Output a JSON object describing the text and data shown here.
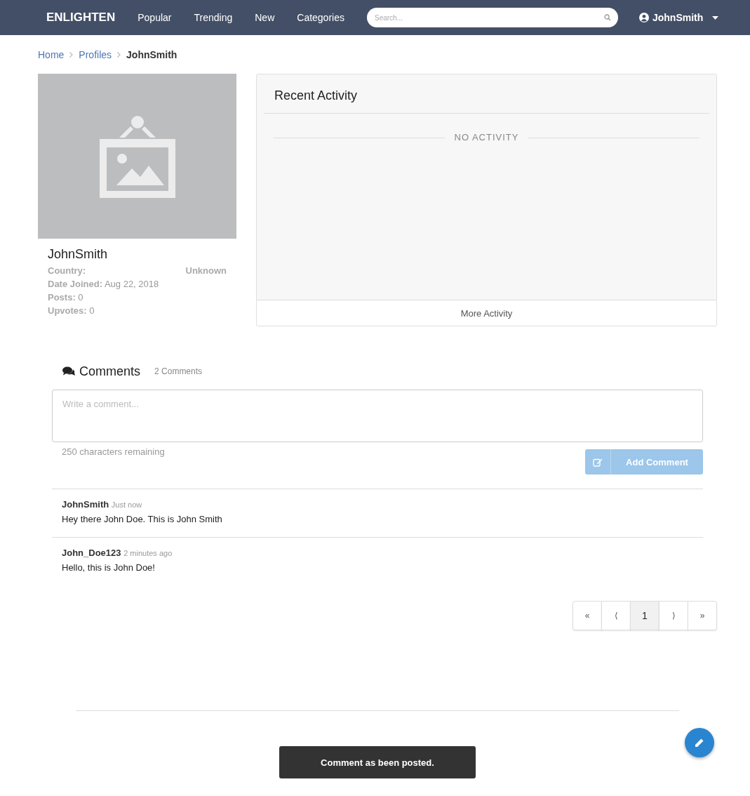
{
  "navbar": {
    "brand": "ENLIGHTEN",
    "links": [
      "Popular",
      "Trending",
      "New",
      "Categories"
    ],
    "search": {
      "placeholder": "Search..."
    },
    "user": "JohnSmith"
  },
  "breadcrumb": [
    {
      "label": "Home",
      "current": false
    },
    {
      "label": "Profiles",
      "current": false
    },
    {
      "label": "JohnSmith",
      "current": true
    }
  ],
  "profile": {
    "name": "JohnSmith",
    "fields": [
      {
        "label": "Country:",
        "value": "Unknown",
        "kind": "split"
      },
      {
        "label": "Date Joined:",
        "value": "Aug 22, 2018",
        "kind": "inline"
      },
      {
        "label": "Posts:",
        "value": "0",
        "kind": "inline"
      },
      {
        "label": "Upvotes:",
        "value": "0",
        "kind": "inline"
      }
    ]
  },
  "activity": {
    "title": "Recent Activity",
    "empty": "NO ACTIVITY",
    "more": "More Activity"
  },
  "comments": {
    "title": "Comments",
    "count": "2 Comments",
    "placeholder": "Write a comment...",
    "remaining": "250 characters remaining",
    "submit": {
      "label": "Add Comment",
      "disabled": true
    },
    "items": [
      {
        "author": "JohnSmith",
        "time": "Just now",
        "text": "Hey there John Doe. This is John Smith"
      },
      {
        "author": "John_Doe123",
        "time": "2 minutes ago",
        "text": "Hello, this is John Doe!"
      }
    ]
  },
  "pagination": [
    {
      "label": "«",
      "selected": false
    },
    {
      "label": "⟨",
      "selected": false
    },
    {
      "label": "1",
      "selected": true
    },
    {
      "label": "⟩",
      "selected": false
    },
    {
      "label": "»",
      "selected": false
    }
  ],
  "toast": "Comment as been posted."
}
